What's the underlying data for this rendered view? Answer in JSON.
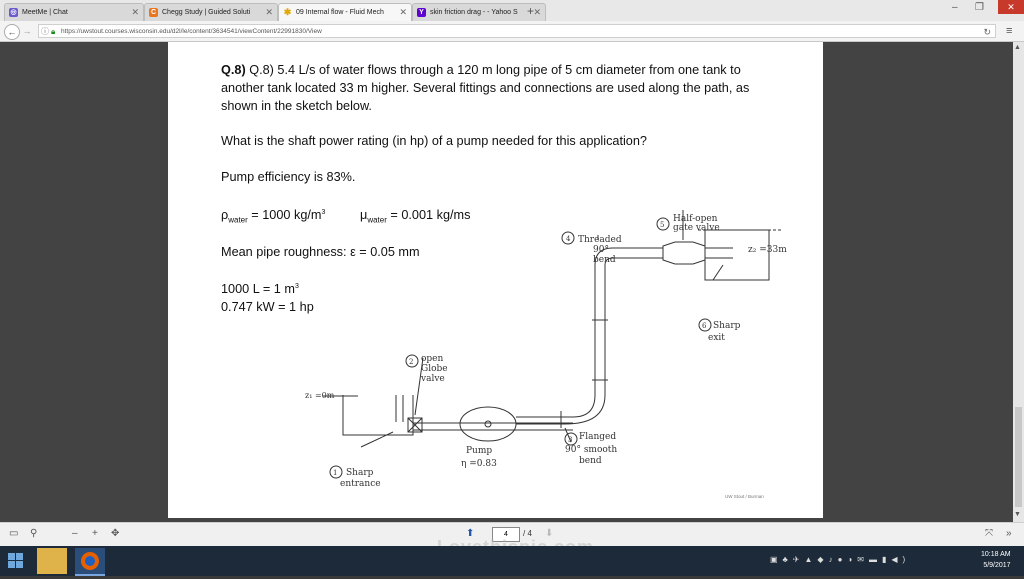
{
  "tabs": [
    {
      "label": "MeetMe | Chat"
    },
    {
      "label": "Chegg Study | Guided Soluti"
    },
    {
      "label": "09 Internal flow - Fluid Mech"
    },
    {
      "label": "skin friction drag - - Yahoo S"
    }
  ],
  "address": {
    "url": "https://uwstout.courses.wisconsin.edu/d2l/le/content/3634541/viewContent/22991830/View"
  },
  "document": {
    "question": "Q.8) 5.4 L/s of water flows through a 120 m long pipe of 5 cm diameter from one tank to another tank located 33 m higher. Several fittings and connections are used along the path, as shown in the sketch below.",
    "prompt": "What is the shaft power rating (in hp) of a pump needed for this application?",
    "efficiency": "Pump efficiency is 83%.",
    "rho_symbol": "ρ",
    "rho_sub": "water",
    "rho_value": " = 1000 kg/m",
    "rho_exp": "3",
    "mu_symbol": "μ",
    "mu_sub": "water",
    "mu_value": " = 0.001 kg/ms",
    "roughness": "Mean pipe roughness:  ε = 0.05 mm",
    "conv1_main": "1000 L = 1 m",
    "conv1_exp": "3",
    "conv2": "0.747 kW = 1 hp",
    "credit": "UW Stout / Burman"
  },
  "sketch": {
    "label1": "Sharp",
    "label1b": "entrance",
    "label2": "open",
    "label2b": "Globe",
    "label2c": "valve",
    "label3": "Flanged",
    "label3b": "90° smooth",
    "label3c": "bend",
    "label4": "Threaded",
    "label4b": "90°",
    "label4c": "bend",
    "label5": "Half-open",
    "label5b": "gate valve",
    "label6": "Sharp",
    "label6b": "exit",
    "z1": "z₁ =0m",
    "z2": "z₂ =33m",
    "pump": "Pump",
    "eta": "η =0.83",
    "n1": "1",
    "n2": "2",
    "n3": "3",
    "n4": "4",
    "n5": "5",
    "n6": "6"
  },
  "viewer": {
    "page_current": "4",
    "page_total": "/ 4"
  },
  "watermark": "Lovethispic.com",
  "taskbar": {
    "time": "10:18 AM",
    "date": "5/9/2017"
  }
}
